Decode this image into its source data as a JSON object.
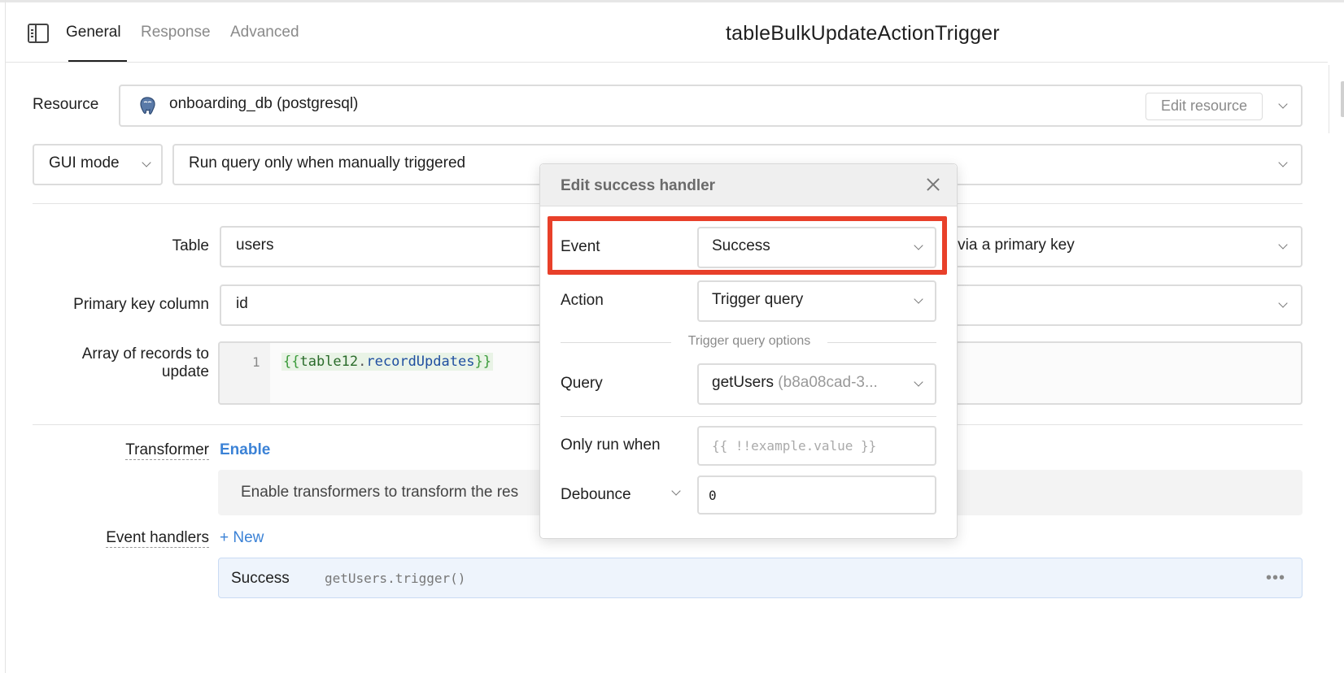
{
  "header": {
    "tabs": [
      {
        "label": "General",
        "active": true
      },
      {
        "label": "Response",
        "active": false
      },
      {
        "label": "Advanced",
        "active": false
      }
    ],
    "title": "tableBulkUpdateActionTrigger"
  },
  "resource": {
    "label": "Resource",
    "value": "onboarding_db (postgresql)",
    "icon": "postgresql-elephant-icon",
    "edit_label": "Edit resource"
  },
  "mode": {
    "value": "GUI mode",
    "trigger_value": "Run query only when manually triggered"
  },
  "table": {
    "label": "Table",
    "value": "users",
    "action_value_partial": "te via a primary key"
  },
  "primary_key": {
    "label": "Primary key column",
    "value": "id"
  },
  "records": {
    "label_line1": "Array of records to",
    "label_line2": "update",
    "line_number": "1",
    "code_open": "{{",
    "code_obj": "table12",
    "code_dot": ".",
    "code_prop": "recordUpdates",
    "code_close": "}}"
  },
  "transformer": {
    "label": "Transformer",
    "link": "Enable",
    "info": "Enable transformers to transform the res"
  },
  "event_handlers": {
    "label": "Event handlers",
    "new_link": "+ New",
    "rows": [
      {
        "event": "Success",
        "action": "getUsers.trigger()",
        "more": "•••"
      }
    ]
  },
  "modal": {
    "title": "Edit success handler",
    "event_label": "Event",
    "event_value": "Success",
    "action_label": "Action",
    "action_value": "Trigger query",
    "options_label": "Trigger query options",
    "query_label": "Query",
    "query_name": "getUsers",
    "query_id": " (b8a08cad-3...",
    "only_run_label": "Only run when",
    "only_run_placeholder": "{{ !!example.value }}",
    "debounce_label": "Debounce",
    "debounce_value": "0"
  },
  "colors": {
    "highlight": "#e8402a",
    "link": "#3b82d6"
  }
}
